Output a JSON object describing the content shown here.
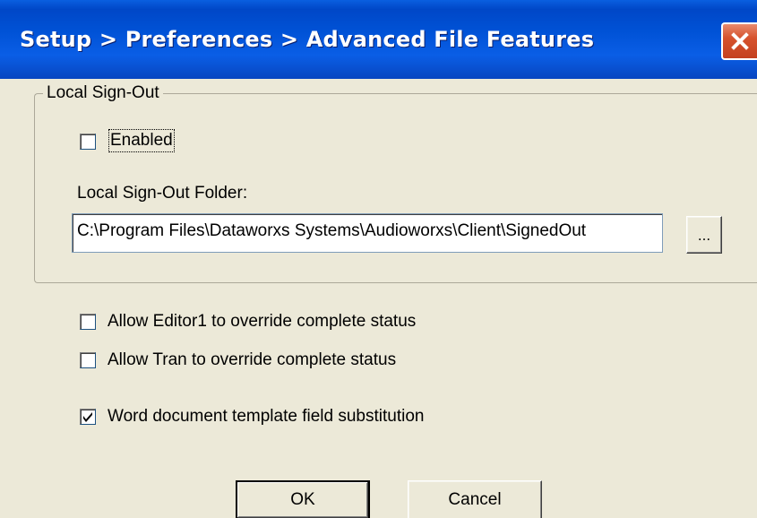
{
  "window": {
    "title": "Setup > Preferences > Advanced File Features"
  },
  "local_signout": {
    "group_label": "Local Sign-Out",
    "enabled_label": "Enabled",
    "enabled_checked": false,
    "folder_label": "Local Sign-Out Folder:",
    "folder_value": "C:\\Program Files\\Dataworxs Systems\\Audioworxs\\Client\\SignedOut",
    "browse_label": "..."
  },
  "options": {
    "editor1_override_label": "Allow Editor1 to override complete status",
    "editor1_override_checked": false,
    "tran_override_label": "Allow Tran to override complete status",
    "tran_override_checked": false,
    "word_template_label": "Word document template field substitution",
    "word_template_checked": true
  },
  "buttons": {
    "ok_label": "OK",
    "cancel_label": "Cancel"
  },
  "colors": {
    "titlebar": "#0052d6",
    "dialog_bg": "#ece9d8",
    "close_button": "#d6532e"
  },
  "icons": {
    "close": "close-icon",
    "check": "checkmark-icon"
  }
}
